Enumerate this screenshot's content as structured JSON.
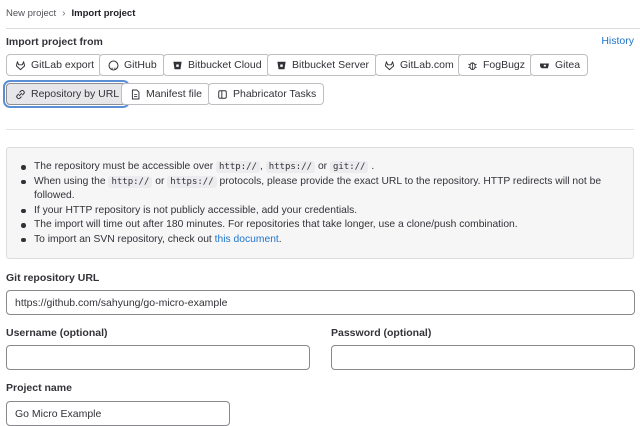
{
  "breadcrumb": {
    "parent": "New project",
    "separator": "›",
    "current": "Import project"
  },
  "import_section": {
    "title": "Import project from",
    "history_link": "History",
    "sources": [
      {
        "label": "GitLab export",
        "icon": "tanuki-icon"
      },
      {
        "label": "GitHub",
        "icon": "github-icon"
      },
      {
        "label": "Bitbucket Cloud",
        "icon": "bitbucket-icon"
      },
      {
        "label": "Bitbucket Server",
        "icon": "bitbucket-icon"
      },
      {
        "label": "GitLab.com",
        "icon": "tanuki-icon"
      },
      {
        "label": "FogBugz",
        "icon": "bug-icon"
      },
      {
        "label": "Gitea",
        "icon": "gitea-icon"
      },
      {
        "label": "Repository by URL",
        "icon": "link-icon",
        "selected": true
      },
      {
        "label": "Manifest file",
        "icon": "file-icon"
      },
      {
        "label": "Phabricator Tasks",
        "icon": "phabricator-icon"
      }
    ]
  },
  "info": {
    "line1_a": "The repository must be accessible over",
    "line1_code1": "http://",
    "line1_b": ",",
    "line1_code2": "https://",
    "line1_c": "or",
    "line1_code3": "git://",
    "line1_d": ".",
    "line2_a": "When using the",
    "line2_code1": "http://",
    "line2_b": "or",
    "line2_code2": "https://",
    "line2_c": "protocols, please provide the exact URL to the repository. HTTP redirects will not be followed.",
    "line3": "If your HTTP repository is not publicly accessible, add your credentials.",
    "line4": "The import will time out after 180 minutes. For repositories that take longer, use a clone/push combination.",
    "line5_a": "To import an SVN repository, check out",
    "line5_link": "this document",
    "line5_b": "."
  },
  "form": {
    "repo_url_label": "Git repository URL",
    "repo_url_value": "https://github.com/sahyung/go-micro-example",
    "username_label": "Username (optional)",
    "username_value": "",
    "password_label": "Password (optional)",
    "password_value": "",
    "project_name_label": "Project name",
    "project_name_value": "Go Micro Example"
  },
  "colors": {
    "link": "#1f75cb",
    "focus_ring": "#5a8fd6",
    "text": "#333238"
  }
}
